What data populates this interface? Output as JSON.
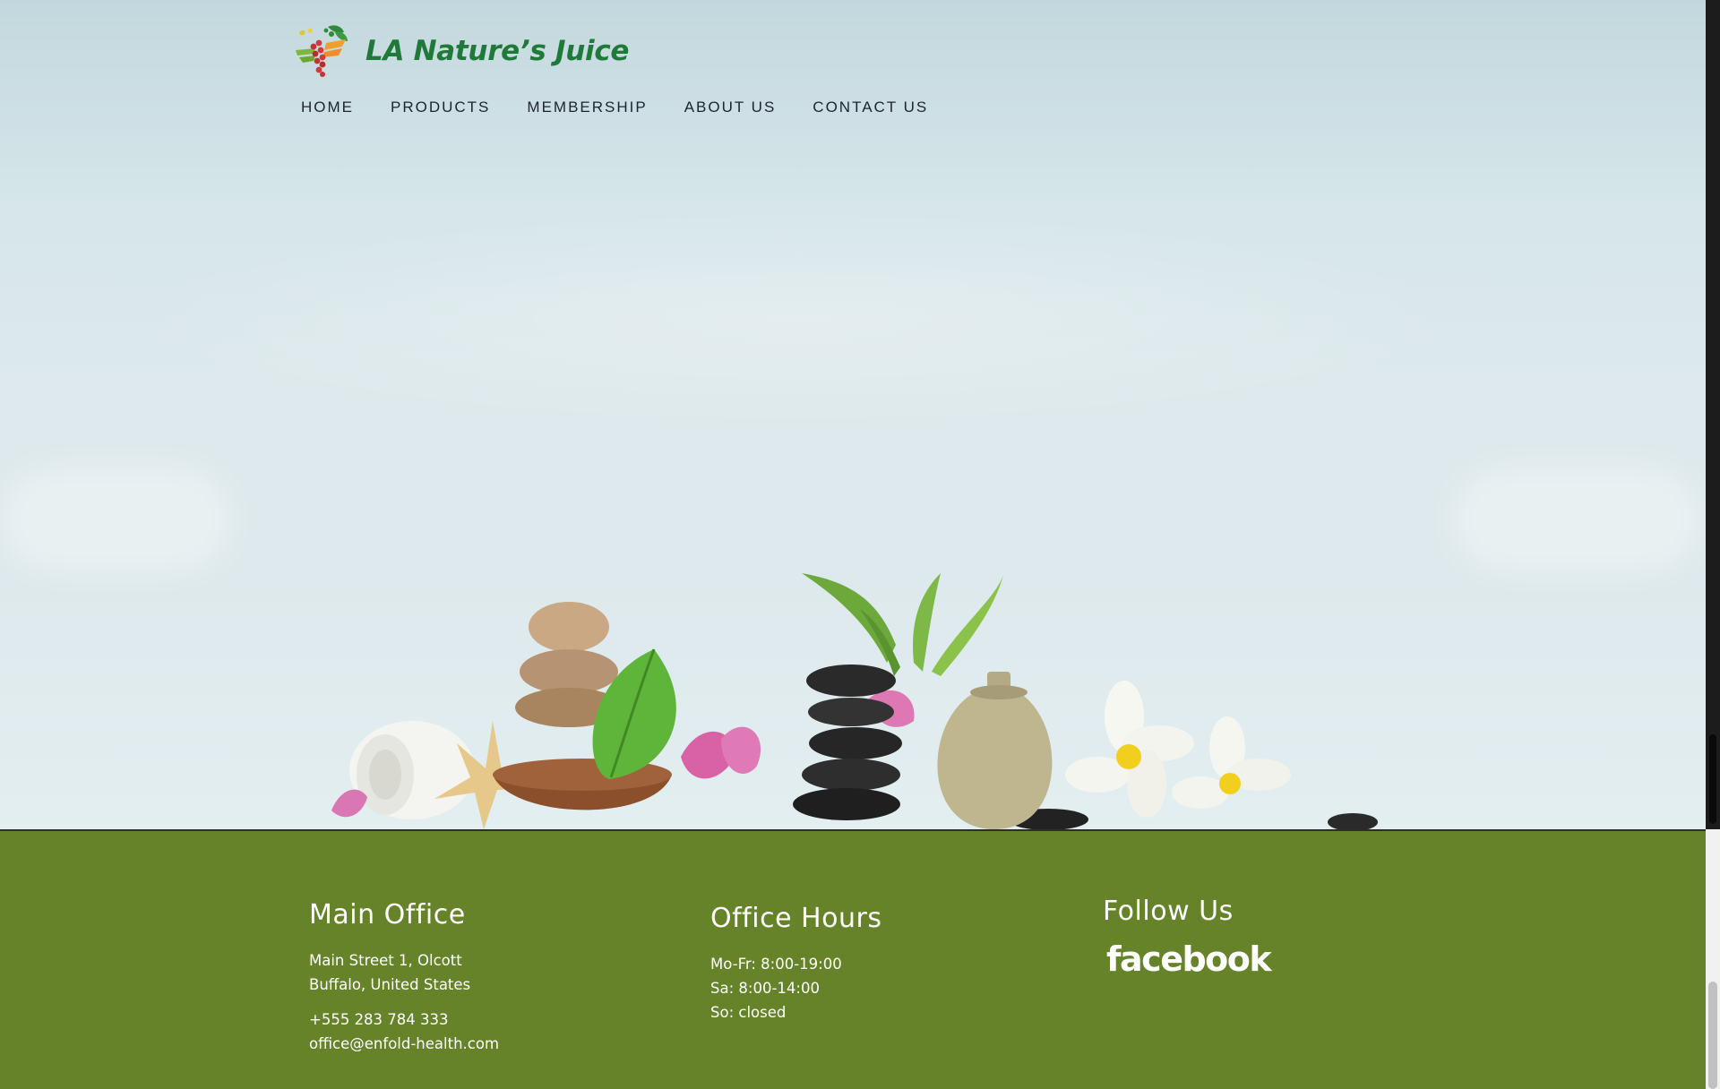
{
  "brand": {
    "name": "LA Nature’s Juice",
    "color": "#1f7a3a"
  },
  "nav": {
    "items": [
      {
        "label": "HOME"
      },
      {
        "label": "PRODUCTS"
      },
      {
        "label": "MEMBERSHIP"
      },
      {
        "label": "ABOUT US"
      },
      {
        "label": "CONTACT US"
      }
    ]
  },
  "footer": {
    "background": "#66832a",
    "main_office": {
      "title": "Main Office",
      "address_line1": "Main Street 1, Olcott",
      "address_line2": "Buffalo, United States",
      "phone": "+555 283 784 333",
      "email": "office@enfold-health.com"
    },
    "office_hours": {
      "title": "Office Hours",
      "lines": [
        "Mo-Fr: 8:00-19:00",
        "Sa: 8:00-14:00",
        "So: closed"
      ]
    },
    "follow": {
      "title": "Follow Us",
      "facebook": "facebook"
    }
  },
  "icons": {
    "logo": "fruit-heart-logo-icon",
    "social": "facebook-icon"
  }
}
